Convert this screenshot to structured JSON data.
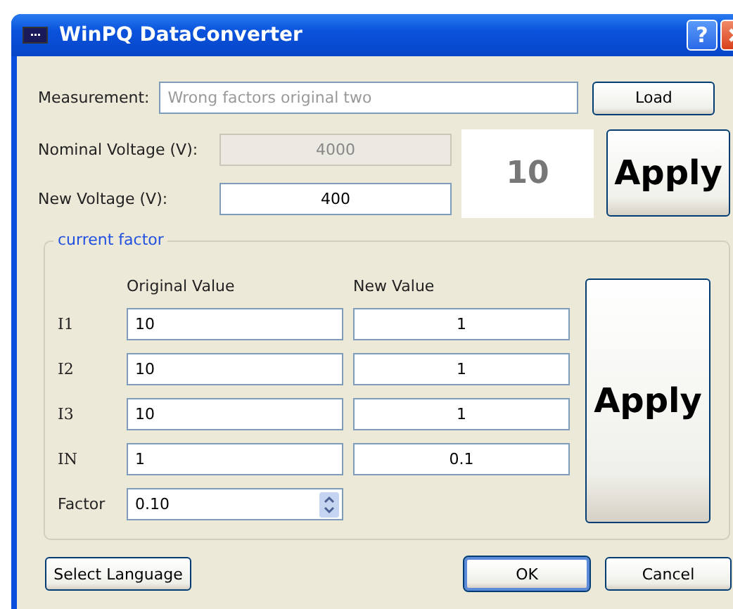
{
  "window": {
    "title": "WinPQ DataConverter",
    "help": "?"
  },
  "measurement": {
    "label": "Measurement:",
    "placeholder": "Wrong factors original two"
  },
  "load_button": "Load",
  "nominal_voltage": {
    "label": "Nominal Voltage (V):",
    "value": "4000",
    "disabled": true
  },
  "new_voltage": {
    "label": "New Voltage (V):",
    "value": "400",
    "disabled": false
  },
  "ratio": "10",
  "apply_button": "Apply",
  "current_factor": {
    "title": "current factor",
    "columns": [
      "Original Value",
      "New Value"
    ],
    "rows": [
      {
        "label": "I1",
        "original": "10",
        "new": "1"
      },
      {
        "label": "I2",
        "original": "10",
        "new": "1"
      },
      {
        "label": "I3",
        "original": "10",
        "new": "1"
      },
      {
        "label": "IN",
        "original": "1",
        "new": "0.1"
      }
    ],
    "factor": {
      "label": "Factor",
      "value": "0.10"
    },
    "apply_button": "Apply"
  },
  "buttons": [
    {
      "label": "Select Language",
      "default": false
    },
    {
      "label": "OK",
      "default": true
    },
    {
      "label": "Cancel",
      "default": false
    }
  ]
}
